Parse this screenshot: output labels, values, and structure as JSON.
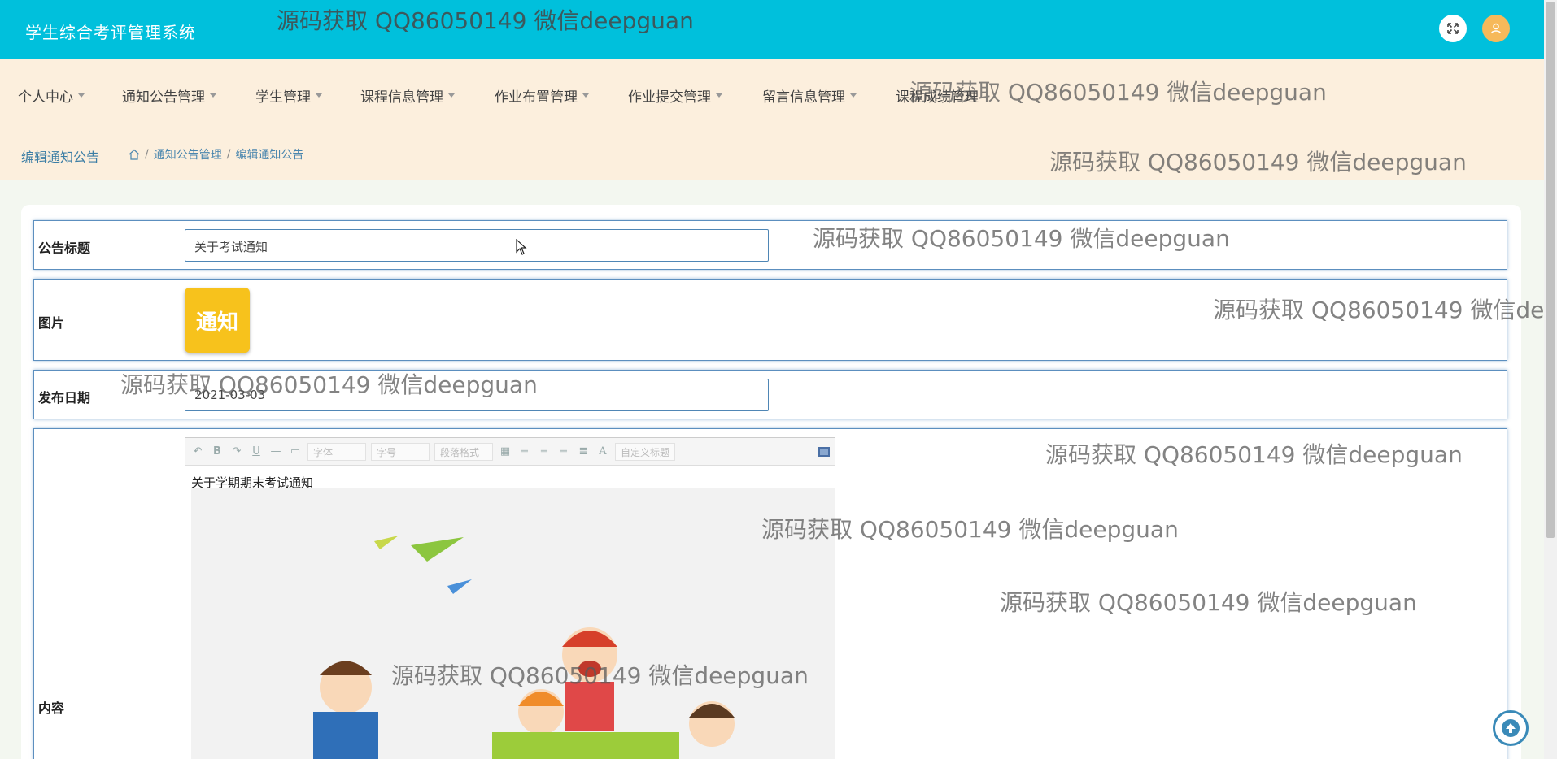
{
  "app": {
    "title": "学生综合考评管理系统"
  },
  "nav": {
    "items": [
      {
        "label": "个人中心"
      },
      {
        "label": "通知公告管理"
      },
      {
        "label": "学生管理"
      },
      {
        "label": "课程信息管理"
      },
      {
        "label": "作业布置管理"
      },
      {
        "label": "作业提交管理"
      },
      {
        "label": "留言信息管理"
      },
      {
        "label": "课程成绩管理"
      }
    ]
  },
  "breadcrumb": {
    "title": "编辑通知公告",
    "items": [
      "通知公告管理",
      "编辑通知公告"
    ],
    "separator": "/"
  },
  "form": {
    "title_label": "公告标题",
    "title_value": "关于考试通知",
    "image_label": "图片",
    "image_text": "通知",
    "date_label": "发布日期",
    "date_value": "2021-03-03",
    "content_label": "内容",
    "content_text": "关于学期期末考试通知"
  },
  "editor": {
    "font_placeholder": "字体",
    "size_placeholder": "字号",
    "para_placeholder": "段落格式",
    "title_placeholder": "自定义标题",
    "icons": [
      "undo-icon",
      "bold-icon",
      "redo-icon",
      "underline-icon",
      "hr-icon",
      "paste-icon",
      "align-icons",
      "font-color-icon",
      "fullscreen-icon"
    ]
  },
  "watermark": "源码获取 QQ86050149 微信deepguan",
  "colors": {
    "header": "#00c0dc",
    "nav_bg": "#fcefdd",
    "accent": "#3c7ea5",
    "thumb": "#f7c21c"
  }
}
